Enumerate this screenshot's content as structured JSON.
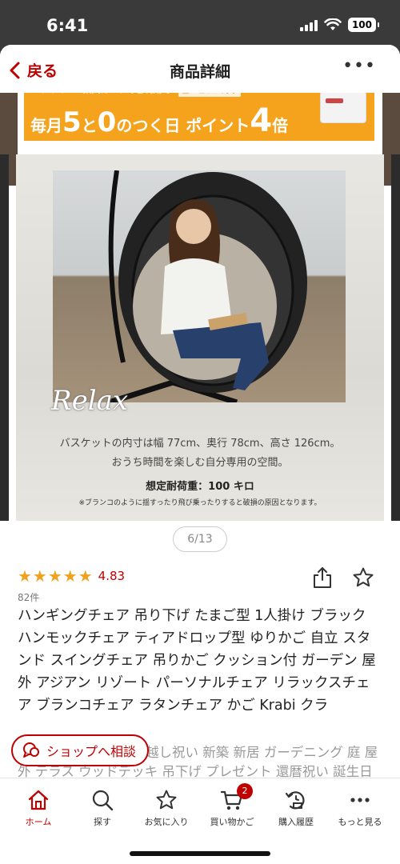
{
  "status_bar": {
    "time": "6:41",
    "battery": "100"
  },
  "nav": {
    "back_label": "戻る",
    "title": "商品詳細",
    "more_label": "•••"
  },
  "banner": {
    "top_text": "エントリー&楽天カードのご利用で",
    "top_chip": "全ショップ対象",
    "prefix": "毎月",
    "num1": "5",
    "mid": "と",
    "num2": "0",
    "suffix": "のつく日 ポイント",
    "num3": "4",
    "end": "倍"
  },
  "product_image": {
    "relax_text": "Relax",
    "line1": "バスケットの内寸は幅 77cm、奥行 78cm、高さ 126cm。",
    "line2": "おうち時間を楽しむ自分専用の空間。",
    "line3": "想定耐荷重：100 キロ",
    "line4": "※ブランコのように揺すったり飛び乗ったりすると破損の原因となります。"
  },
  "pager": {
    "text": "6/13"
  },
  "rating": {
    "stars": "★★★★★",
    "value": "4.83",
    "count": "82件"
  },
  "product": {
    "title": "ハンギングチェア 吊り下げ たまご型 1人掛け ブラック ハンモックチェア ティアドロップ型 ゆりかご 自立 スタンド スイングチェア 吊りかご クッション付 ガーデン 屋外 アジアン リゾート パーソナルチェア リラックスチェア ブランコチェア ラタンチェア かご Krabi クラ",
    "subtitle_row1": "越し祝い 新築 新居 ガーデニング 庭 屋",
    "subtitle_row2": "外 テラス ウッドデッキ 吊下げ プレゼント 還暦祝い 誕生日"
  },
  "shop_button": {
    "label": "ショップへ相談"
  },
  "tabbar": {
    "items": [
      {
        "label": "ホーム",
        "icon": "home-icon"
      },
      {
        "label": "探す",
        "icon": "search-icon"
      },
      {
        "label": "お気に入り",
        "icon": "star-icon"
      },
      {
        "label": "買い物かご",
        "icon": "cart-icon",
        "badge": "2"
      },
      {
        "label": "購入履歴",
        "icon": "history-icon"
      },
      {
        "label": "もっと見る",
        "icon": "more-icon"
      }
    ]
  },
  "colors": {
    "accent": "#bf0000",
    "star": "#f0a21c",
    "banner": "#f5a21c"
  }
}
